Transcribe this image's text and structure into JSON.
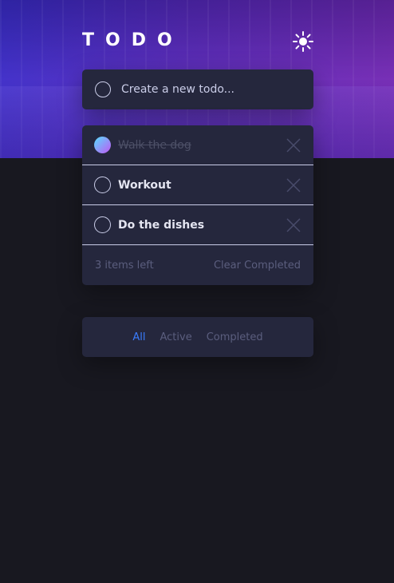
{
  "app": {
    "title": "TODO",
    "theme_toggle_icon": "sun-icon"
  },
  "new_todo": {
    "placeholder": "Create a new todo..."
  },
  "todos": [
    {
      "text": "Walk the dog",
      "completed": true
    },
    {
      "text": "Workout",
      "completed": false
    },
    {
      "text": "Do the dishes",
      "completed": false
    }
  ],
  "footer": {
    "items_left": "3 items left",
    "clear_completed": "Clear Completed"
  },
  "filters": {
    "all": "All",
    "active": "Active",
    "completed": "Completed",
    "selected": "all"
  },
  "colors": {
    "background": "#181820",
    "card": "#25273d",
    "text": "#e4e5f1",
    "muted": "#5b5e7e",
    "accent": "#3a7cfd",
    "check_gradient_start": "#57ddff",
    "check_gradient_end": "#c058f3"
  }
}
